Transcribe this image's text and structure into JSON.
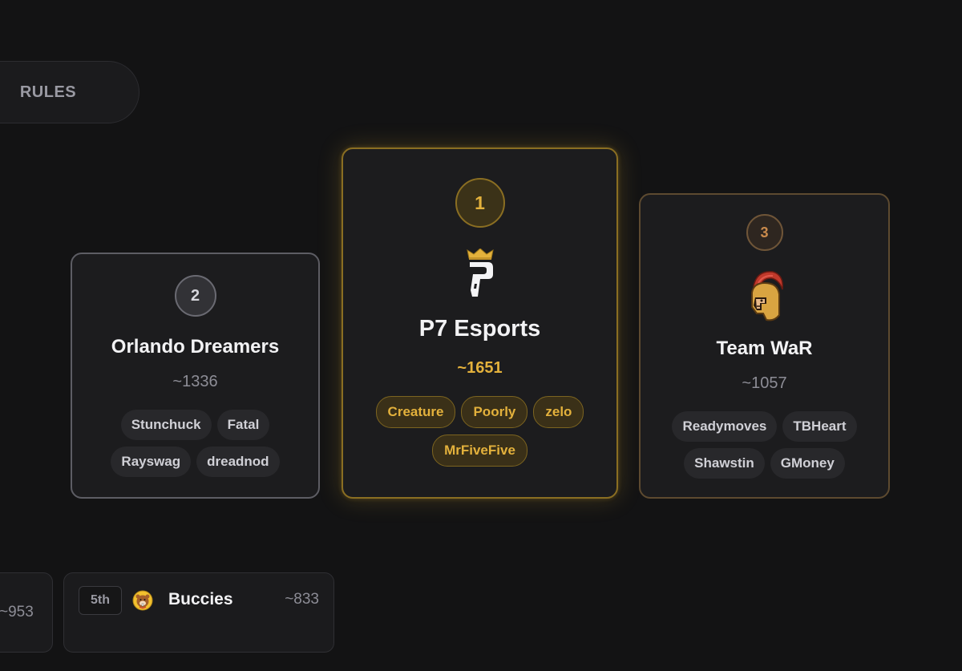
{
  "tabs": {
    "rules_label": "RULES"
  },
  "podium": [
    {
      "position": "first",
      "rank": "1",
      "team": "P7 Esports",
      "rating": "~1651",
      "logo_icon": "p7-esports-logo-icon",
      "players": [
        "Creature",
        "Poorly",
        "zelo",
        "MrFiveFive"
      ]
    },
    {
      "position": "second",
      "rank": "2",
      "team": "Orlando Dreamers",
      "rating": "~1336",
      "players": [
        "Stunchuck",
        "Fatal",
        "Rayswag",
        "dreadnod"
      ]
    },
    {
      "position": "third",
      "rank": "3",
      "team": "Team WaR",
      "rating": "~1057",
      "logo_icon": "spartan-helmet-logo-icon",
      "players": [
        "Readymoves",
        "TBHeart",
        "Shawstin",
        "GMoney"
      ]
    }
  ],
  "standings": [
    {
      "place": "",
      "team": "",
      "rating": "~953"
    },
    {
      "place": "5th",
      "team": "Buccies",
      "rating": "~833",
      "logo_icon": "beaver-logo-icon"
    }
  ],
  "colors": {
    "background": "#131314",
    "gold_accent": "#e3b13c",
    "silver_accent": "#6a6a72",
    "bronze_accent": "#c98a4c"
  }
}
